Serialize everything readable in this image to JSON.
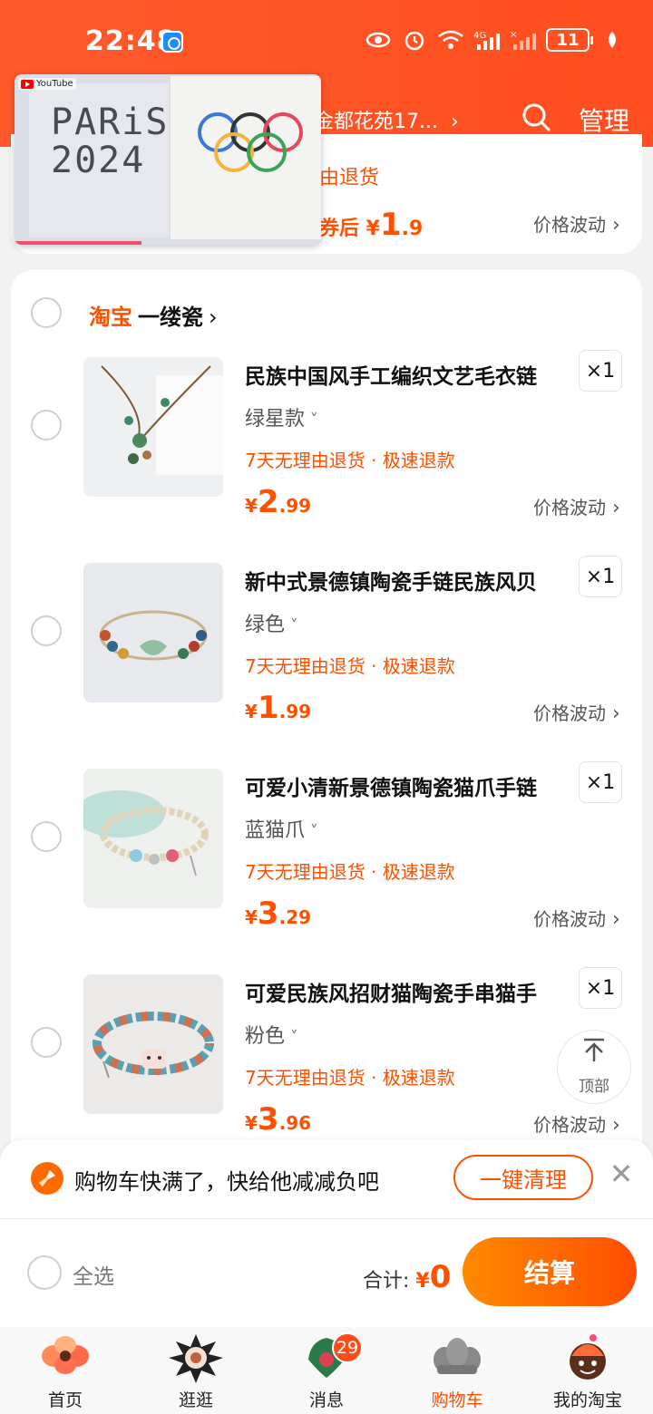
{
  "status_bar": {
    "time": "22:48",
    "battery": "11",
    "icons": [
      "eye-icon",
      "alarm-icon",
      "wifi-icon",
      "signal-4g-icon",
      "signal-icon",
      "battery-icon",
      "leaf-icon"
    ]
  },
  "header": {
    "address": "金都花苑17...",
    "address_chevron": "›",
    "manage_label": "管理"
  },
  "pip_video": {
    "source_label": "YouTube",
    "poster_text_line1": "PARiS",
    "poster_text_line2": "2024"
  },
  "previous_item": {
    "promise_text": "由退货",
    "price_text": "券后 ¥1.9",
    "price_prefix": "券后 ¥",
    "price_value": "1",
    "price_decimal": ".9",
    "fluct_label": "价格波动"
  },
  "shop": {
    "platform": "淘宝",
    "name": "一缕瓷",
    "chevron": "›"
  },
  "items": [
    {
      "title": "民族中国风手工编织文艺毛衣链",
      "variant": "绿星款",
      "promise": "7天无理由退货 · 极速退款",
      "currency": "¥",
      "price_int": "2",
      "price_dec": ".99",
      "quantity": "×1",
      "fluct_label": "价格波动"
    },
    {
      "title": "新中式景德镇陶瓷手链民族风贝",
      "variant": "绿色",
      "promise": "7天无理由退货 · 极速退款",
      "currency": "¥",
      "price_int": "1",
      "price_dec": ".99",
      "quantity": "×1",
      "fluct_label": "价格波动"
    },
    {
      "title": "可爱小清新景德镇陶瓷猫爪手链",
      "variant": "蓝猫爪",
      "promise": "7天无理由退货 · 极速退款",
      "currency": "¥",
      "price_int": "3",
      "price_dec": ".29",
      "quantity": "×1",
      "fluct_label": "价格波动"
    },
    {
      "title": "可爱民族风招财猫陶瓷手串猫手",
      "variant": "粉色",
      "promise": "7天无理由退货 · 极速退款",
      "currency": "¥",
      "price_int": "3",
      "price_dec": ".96",
      "quantity": "×1",
      "fluct_label": "价格波动"
    }
  ],
  "back_to_top": {
    "label": "顶部",
    "arrow": "⌃"
  },
  "banner": {
    "message": "购物车快满了，快给他减减负吧",
    "clean_label": "一键清理",
    "close_glyph": "✕"
  },
  "checkout": {
    "select_all_label": "全选",
    "total_label": "合计:",
    "currency": "¥",
    "total_amount": "0",
    "pay_label": "结算"
  },
  "tabbar": {
    "tabs": [
      {
        "label": "首页",
        "icon": "home-flower-icon"
      },
      {
        "label": "逛逛",
        "icon": "explore-icon"
      },
      {
        "label": "消息",
        "icon": "message-icon"
      },
      {
        "label": "购物车",
        "icon": "cart-icon"
      },
      {
        "label": "我的淘宝",
        "icon": "profile-icon"
      }
    ],
    "message_badge": "29",
    "active_index": 3
  },
  "colors": {
    "brand_orange": "#ff5000",
    "header": "#ff5a2c"
  }
}
